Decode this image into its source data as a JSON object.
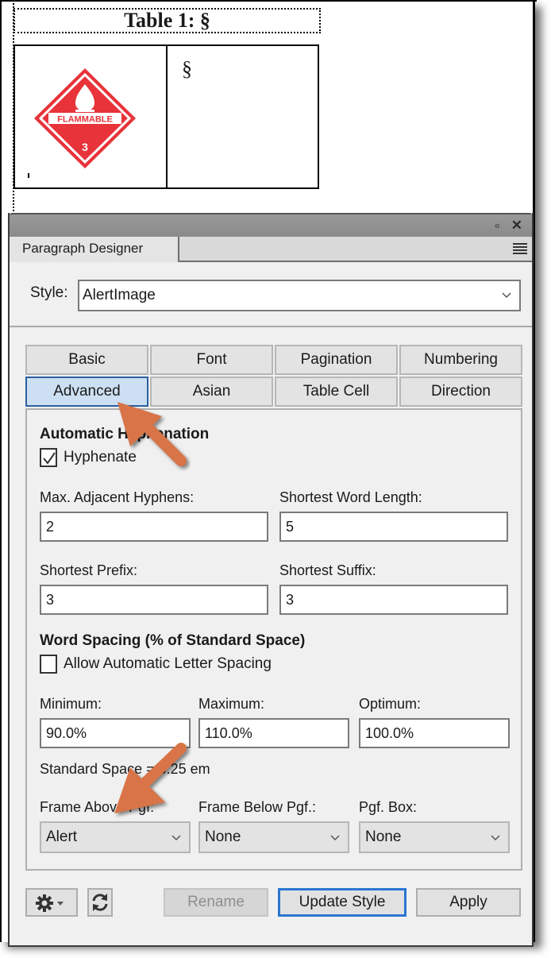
{
  "document": {
    "table_title": "Table 1: §",
    "cell_marker": "§",
    "image_alt": "Flammable hazard placard class 3",
    "placard": {
      "text": "FLAMMABLE",
      "class_number": "3",
      "color": "#e8333a"
    }
  },
  "panel": {
    "collapse_label": "«",
    "close_label": "✕",
    "tab_label": "Paragraph Designer",
    "style": {
      "label": "Style:",
      "value": "AlertImage"
    },
    "tabs": [
      {
        "label": "Basic",
        "active": false
      },
      {
        "label": "Font",
        "active": false
      },
      {
        "label": "Pagination",
        "active": false
      },
      {
        "label": "Numbering",
        "active": false
      },
      {
        "label": "Advanced",
        "active": true
      },
      {
        "label": "Asian",
        "active": false
      },
      {
        "label": "Table Cell",
        "active": false
      },
      {
        "label": "Direction",
        "active": false
      }
    ],
    "advanced": {
      "hyphenation_heading": "Automatic Hyphenation",
      "hyphenate": {
        "label": "Hyphenate",
        "checked": true
      },
      "max_adjacent_hyphens": {
        "label": "Max. Adjacent Hyphens:",
        "value": "2"
      },
      "shortest_word_length": {
        "label": "Shortest Word Length:",
        "value": "5"
      },
      "shortest_prefix": {
        "label": "Shortest Prefix:",
        "value": "3"
      },
      "shortest_suffix": {
        "label": "Shortest Suffix:",
        "value": "3"
      },
      "word_spacing_heading": "Word Spacing (% of Standard Space)",
      "allow_letter_spacing": {
        "label": "Allow Automatic Letter Spacing",
        "checked": false
      },
      "minimum": {
        "label": "Minimum:",
        "value": "90.0%"
      },
      "maximum": {
        "label": "Maximum:",
        "value": "110.0%"
      },
      "optimum": {
        "label": "Optimum:",
        "value": "100.0%"
      },
      "standard_space": "Standard Space = 0.25 em",
      "frame_above": {
        "label": "Frame Above Pgf:",
        "value": "Alert"
      },
      "frame_below": {
        "label": "Frame Below Pgf.:",
        "value": "None"
      },
      "pgf_box": {
        "label": "Pgf. Box:",
        "value": "None"
      }
    },
    "footer": {
      "rename_label": "Rename",
      "update_style_label": "Update Style",
      "apply_label": "Apply"
    }
  },
  "annotations": {
    "arrow_color": "#d87447"
  }
}
